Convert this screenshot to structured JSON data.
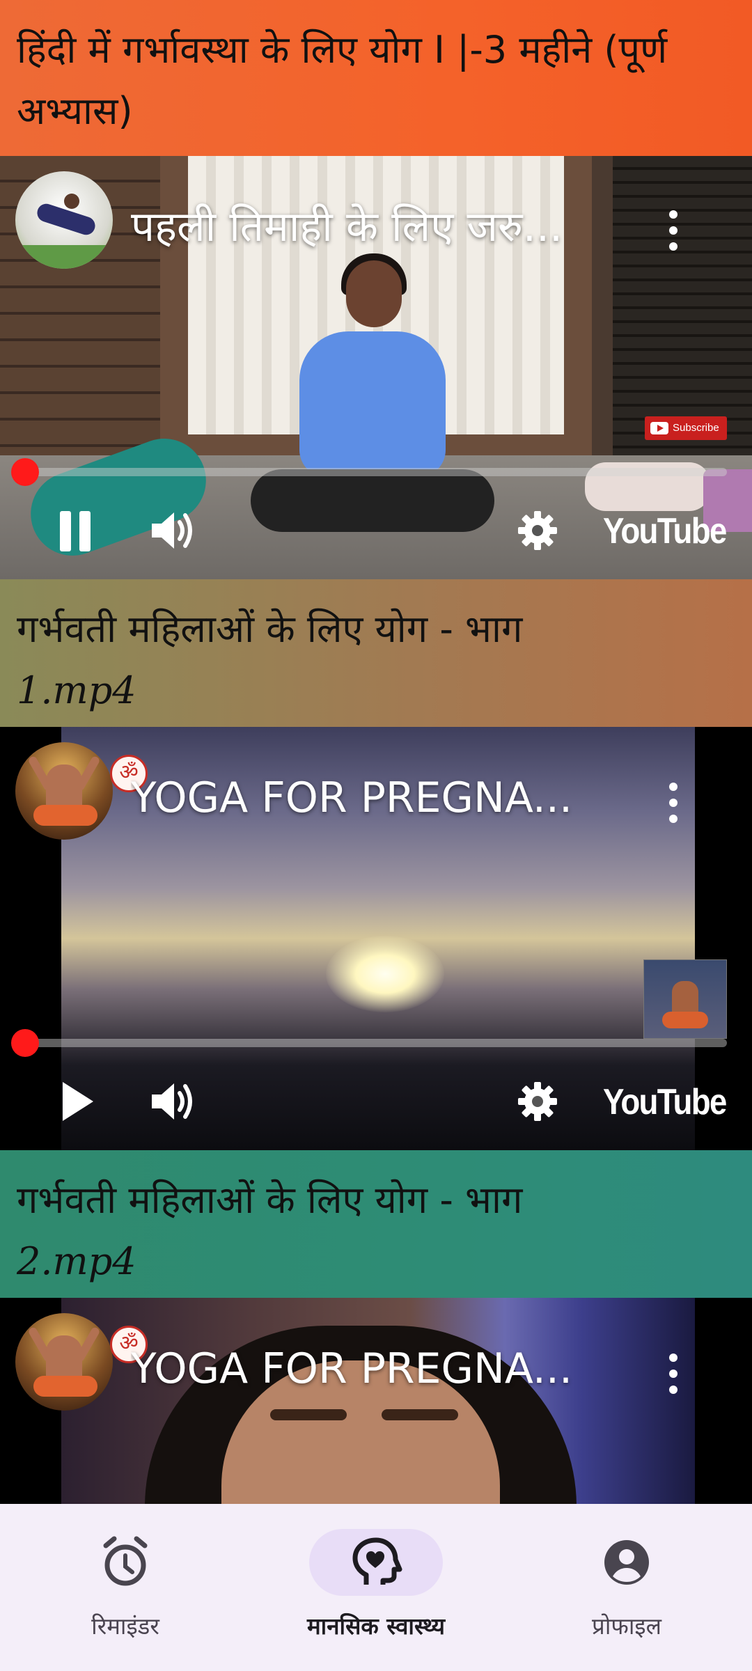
{
  "section1": {
    "title": "हिंदी में गर्भावस्था के लिए योग I |-3 महीने (पूर्ण अभ्यास)"
  },
  "videos": [
    {
      "title": "पहली तिमाही के लिए जरु...",
      "state": "playing",
      "overlay_button": "Subscribe",
      "brand": "YouTube",
      "progress": 0.0
    },
    {
      "title": "YOGA FOR PREGNA...",
      "state": "paused",
      "brand": "YouTube",
      "progress": 0.0
    },
    {
      "title": "YOGA FOR PREGNA..."
    }
  ],
  "captions": [
    {
      "line1": "गर्भवती महिलाओं के लिए योग - भाग",
      "line2": "1.mp4"
    },
    {
      "line1": "गर्भवती महिलाओं के लिए योग - भाग",
      "line2": "2.mp4"
    }
  ],
  "bottom_nav": {
    "items": [
      {
        "label": "रिमाइंडर",
        "icon": "alarm-clock-icon",
        "active": false
      },
      {
        "label": "मानसिक स्वास्थ्य",
        "icon": "mental-health-icon",
        "active": true
      },
      {
        "label": "प्रोफाइल",
        "icon": "account-circle-icon",
        "active": false
      }
    ]
  },
  "colors": {
    "banner1": "#f4622a",
    "banner2": "#a27a52",
    "banner3": "#2e8c76",
    "progress": "#ff1a1a",
    "nav_bg": "#f4eef9",
    "nav_active_pill": "#e8ddf7"
  }
}
